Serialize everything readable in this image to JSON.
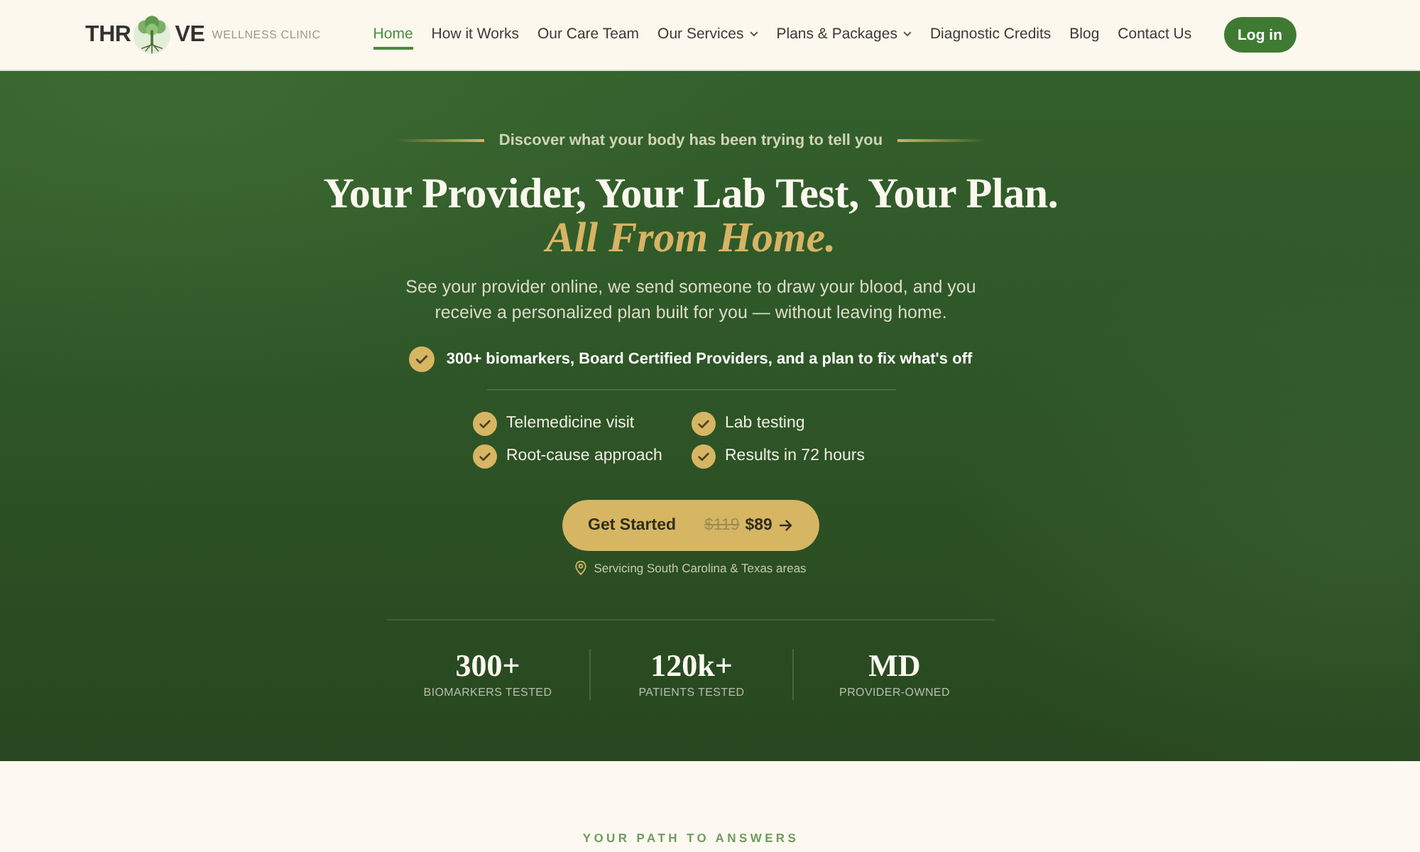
{
  "header": {
    "logo": {
      "left": "THR",
      "right": "VE",
      "tagline": "WELLNESS CLINIC"
    },
    "nav": [
      {
        "label": "Home",
        "selected": true,
        "has_menu": false
      },
      {
        "label": "How it Works",
        "selected": false,
        "has_menu": false
      },
      {
        "label": "Our Care Team",
        "selected": false,
        "has_menu": false
      },
      {
        "label": "Our Services",
        "selected": false,
        "has_menu": true
      },
      {
        "label": "Plans & Packages",
        "selected": false,
        "has_menu": true
      },
      {
        "label": "Diagnostic Credits",
        "selected": false,
        "has_menu": false
      },
      {
        "label": "Blog",
        "selected": false,
        "has_menu": false
      },
      {
        "label": "Contact Us",
        "selected": false,
        "has_menu": false
      }
    ],
    "login_button": "Log in"
  },
  "hero": {
    "eyebrow": "Discover what your body has been trying to tell you",
    "headline": "Your Provider, Your Lab Test, Your Plan.",
    "headline_accent": "All From Home.",
    "description": "See your provider online, we send someone to draw your blood, and you receive a personalized plan built for you — without leaving home.",
    "highlight": "300+ biomarkers, Board Certified Providers, and a plan to fix what's off",
    "features": [
      "Telemedicine visit",
      "Lab testing",
      "Root-cause approach",
      "Results in 72 hours"
    ],
    "cta": {
      "label": "Get Started",
      "old_price": "$119",
      "price": "$89"
    },
    "service_area": "Servicing South Carolina & Texas areas",
    "stats": [
      {
        "value": "300+",
        "label": "BIOMARKERS TESTED"
      },
      {
        "value": "120k+",
        "label": "PATIENTS TESTED"
      },
      {
        "value": "MD",
        "label": "PROVIDER-OWNED"
      }
    ]
  },
  "next_section": {
    "eyebrow": "YOUR PATH TO ANSWERS"
  }
}
